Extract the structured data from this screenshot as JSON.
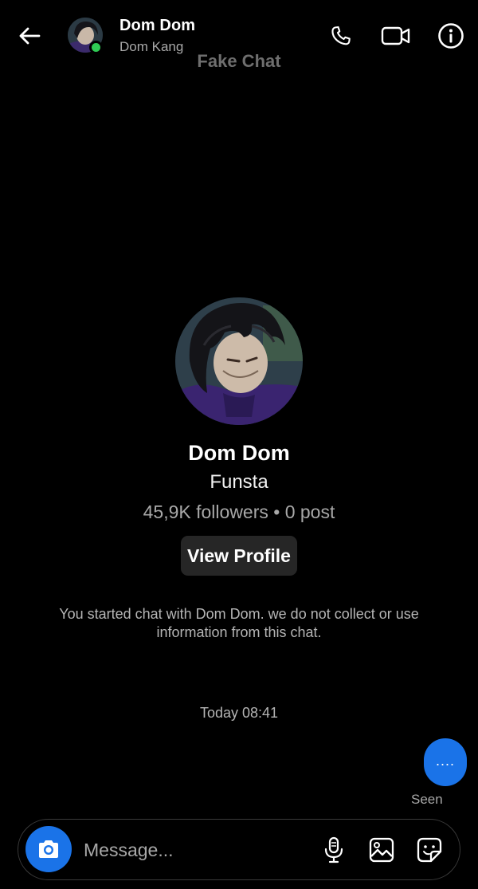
{
  "header": {
    "contact_name": "Dom Dom",
    "contact_username": "Dom Kang",
    "watermark": "Fake Chat",
    "icons": {
      "back": "arrow-left-icon",
      "call": "phone-icon",
      "video": "video-camera-icon",
      "info": "info-icon"
    },
    "online_color": "#2fcb54"
  },
  "profile": {
    "name": "Dom Dom",
    "subtitle": "Funsta",
    "stats": "45,9K followers • 0 post",
    "view_profile_label": "View Profile"
  },
  "chat": {
    "notice": "You started chat with Dom Dom. we do not collect or use information from this chat.",
    "timestamp": "Today 08:41",
    "typing_indicator": "....",
    "seen_label": "Seen"
  },
  "composer": {
    "placeholder": "Message...",
    "icons": {
      "camera": "camera-icon",
      "mic": "microphone-icon",
      "gallery": "image-icon",
      "sticker": "sticker-icon"
    }
  },
  "colors": {
    "accent": "#1a73e8",
    "background": "#000000",
    "button_bg": "#262626"
  }
}
